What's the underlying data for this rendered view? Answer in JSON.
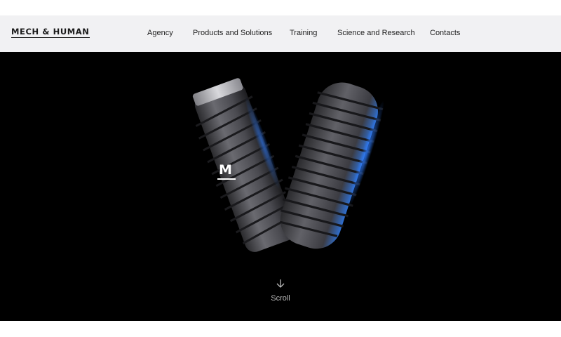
{
  "brand": {
    "logo_text": "MECH & HUMAN"
  },
  "nav": {
    "items": [
      {
        "label": "Agency"
      },
      {
        "label": "Products and Solutions"
      },
      {
        "label": "Training"
      },
      {
        "label": "Science and Research"
      },
      {
        "label": "Contacts"
      }
    ]
  },
  "hero": {
    "headline_fragment": "M",
    "scroll_label": "Scroll",
    "scroll_icon": "arrow-down-icon",
    "image": "two-dental-implants",
    "accent_color": "#3a8bff"
  }
}
